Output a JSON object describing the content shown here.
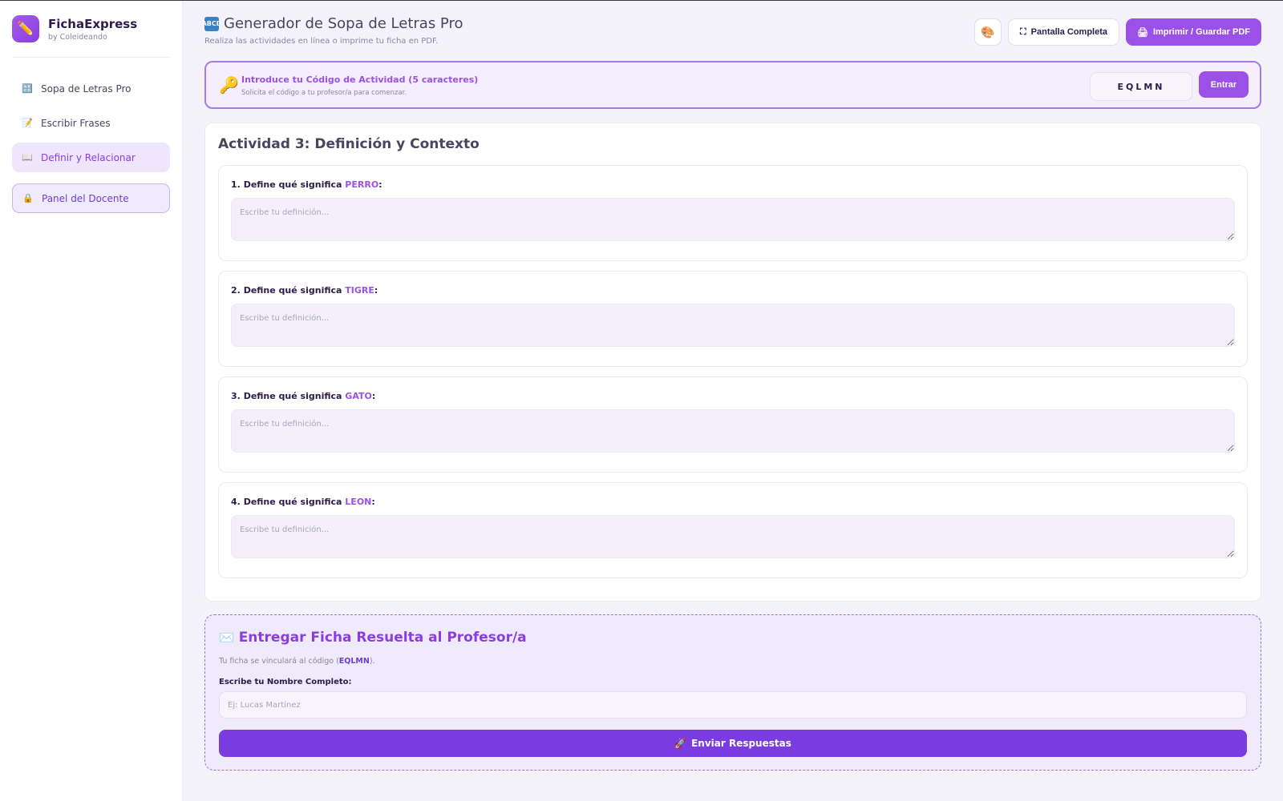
{
  "brand": {
    "name": "FichaExpress",
    "subtitle": "by Coleideando",
    "logo_icon": "✏️"
  },
  "sidebar": {
    "items": [
      {
        "label": "Sopa de Letras Pro",
        "icon": "🔠",
        "active": false
      },
      {
        "label": "Escribir Frases",
        "icon": "📝",
        "active": false
      },
      {
        "label": "Definir y Relacionar",
        "icon": "📖",
        "active": true
      }
    ],
    "docente": {
      "label": "Panel del Docente",
      "icon": "🔒"
    }
  },
  "header": {
    "title": "Generador de Sopa de Letras Pro",
    "title_icon": "ABCD",
    "subtitle": "Realiza las actividades en línea o imprime tu ficha en PDF.",
    "theme_icon": "🎨",
    "fullscreen_label": "Pantalla Completa",
    "fullscreen_icon": "⛶",
    "print_label": "Imprimir / Guardar PDF",
    "print_icon": "🖨"
  },
  "code": {
    "title": "Introduce tu Código de Actividad (5 caracteres)",
    "subtitle": "Solicita el código a tu profesor/a para comenzar.",
    "value": "EQLMN",
    "button": "Entrar",
    "icon": "🔑"
  },
  "activity": {
    "title": "Actividad 3: Definición y Contexto",
    "prefix": "Define qué significa",
    "placeholder": "Escribe tu definición...",
    "questions": [
      {
        "num": "1.",
        "word": "PERRO"
      },
      {
        "num": "2.",
        "word": "TIGRE"
      },
      {
        "num": "3.",
        "word": "GATO"
      },
      {
        "num": "4.",
        "word": "LEON"
      }
    ]
  },
  "submit": {
    "icon": "✉️",
    "title": "Entregar Ficha Resuelta al Profesor/a",
    "info_prefix": "Tu ficha se vinculará al código (",
    "info_code": "EQLMN",
    "info_suffix": ").",
    "name_label": "Escribe tu Nombre Completo:",
    "name_placeholder": "Ej: Lucas Martínez",
    "button": "Enviar Respuestas",
    "button_icon": "🚀"
  },
  "colors": {
    "accent": "#9b51e8",
    "accent_dark": "#7a3be0",
    "background": "#f4f2fb"
  }
}
